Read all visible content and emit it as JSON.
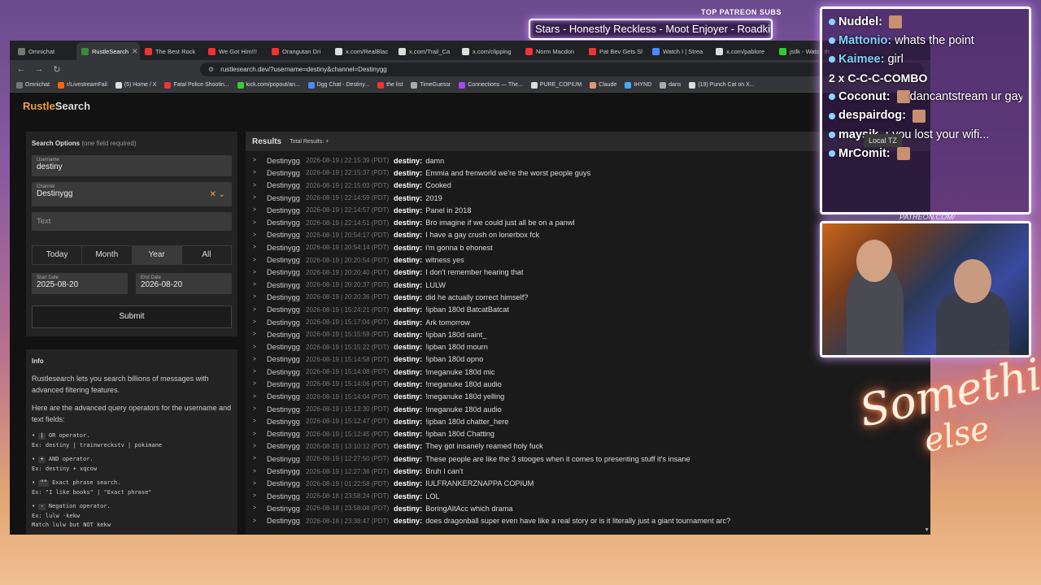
{
  "overlay": {
    "patreon_subs_label": "TOP PATREON SUBS",
    "subs_ticker": "Stars - Honestly Reckless - Moot Enjoyer - Roadkill - JRB",
    "patreon_url_label": "PATREON.COM/",
    "neon_line1": "Something",
    "neon_line2": "else"
  },
  "browser": {
    "tabs": [
      {
        "label": "Omnichat",
        "color": "#777"
      },
      {
        "label": "RustleSearch",
        "color": "#3a8a3a",
        "active": true
      },
      {
        "label": "The Best Rock",
        "color": "#e33"
      },
      {
        "label": "We Got Him!!!",
        "color": "#e33"
      },
      {
        "label": "Orangutan Dri",
        "color": "#e33"
      },
      {
        "label": "x.com/RealBlac",
        "color": "#ddd"
      },
      {
        "label": "x.com/Trail_Ca",
        "color": "#ddd"
      },
      {
        "label": "x.com/clipping",
        "color": "#ddd"
      },
      {
        "label": "Norm Macdon",
        "color": "#e33"
      },
      {
        "label": "Pat Bev Gets Sl",
        "color": "#e33"
      },
      {
        "label": "Watch I | Strea",
        "color": "#4a8aff"
      },
      {
        "label": "x.com/pablore",
        "color": "#ddd"
      },
      {
        "label": "jstlk - Watch th",
        "color": "#3c3"
      }
    ],
    "url": "rustlesearch.dev/?username=destiny&channel=Destinygg",
    "bookmarks": [
      {
        "label": "Omnichat",
        "color": "#777"
      },
      {
        "label": "r/LivestreamFail",
        "color": "#f60"
      },
      {
        "label": "(5) Home / X",
        "color": "#ddd"
      },
      {
        "label": "Fatal Police Shootin...",
        "color": "#e33"
      },
      {
        "label": "kick.com/popout/an...",
        "color": "#3c3"
      },
      {
        "label": "Dgg Chat - Destiny...",
        "color": "#4a8aff"
      },
      {
        "label": "the list",
        "color": "#e33"
      },
      {
        "label": "TimeGuessr",
        "color": "#aaa"
      },
      {
        "label": "Connections — The...",
        "color": "#a4f"
      },
      {
        "label": "PURE_COPIUM",
        "color": "#ddd"
      },
      {
        "label": "Claude",
        "color": "#d97"
      },
      {
        "label": "IHYND",
        "color": "#4af"
      },
      {
        "label": "dans",
        "color": "#aaa"
      },
      {
        "label": "(19) Punch Cat on X...",
        "color": "#ddd"
      }
    ]
  },
  "site": {
    "logo_a": "Rustle",
    "logo_b": "Search",
    "search": {
      "title": "Search Options",
      "subtitle": "(one field required)",
      "username_label": "Username",
      "username_value": "destiny",
      "channel_label": "Channel",
      "channel_value": "Destinygg",
      "text_placeholder": "Text",
      "ranges": [
        "Today",
        "Month",
        "Year",
        "All"
      ],
      "active_range": "Year",
      "start_label": "Start Date",
      "start_value": "2025-08-20",
      "end_label": "End Date",
      "end_value": "2026-08-20",
      "submit": "Submit"
    },
    "info": {
      "title": "Info",
      "p1": "Rustlesearch lets you search billions of messages with advanced filtering features.",
      "p2": "Here are the advanced query operators for the username and text fields:",
      "ops": [
        {
          "sym": "|",
          "desc": "OR operator.",
          "ex": "Ex: destiny | trainwreckstv | pokimane"
        },
        {
          "sym": "+",
          "desc": "AND operator.",
          "ex": "Ex: destiny + xqcow"
        },
        {
          "sym": "\"\"",
          "desc": "Exact phrase search.",
          "ex": "Ex: \"I like books\" | \"Exact phrase\""
        },
        {
          "sym": "-",
          "desc": "Negation operator.",
          "ex": "Ex: lulw -kekw",
          "ex2": "Match lulw but NOT kekw"
        }
      ]
    },
    "results": {
      "title": "Results",
      "count": "Total Results: +",
      "rows": [
        {
          "chan": "Destinygg",
          "ts": "2026-08-19 | 22:15:39 (PDT)",
          "user": "destiny:",
          "msg": "damn"
        },
        {
          "chan": "Destinygg",
          "ts": "2026-08-19 | 22:15:37 (PDT)",
          "user": "destiny:",
          "msg": "Emmia and frenworld we're the worst people guys"
        },
        {
          "chan": "Destinygg",
          "ts": "2026-08-19 | 22:15:03 (PDT)",
          "user": "destiny:",
          "msg": "Cooked"
        },
        {
          "chan": "Destinygg",
          "ts": "2026-08-19 | 22:14:59 (PDT)",
          "user": "destiny:",
          "msg": "2019"
        },
        {
          "chan": "Destinygg",
          "ts": "2026-08-19 | 22:14:57 (PDT)",
          "user": "destiny:",
          "msg": "Panel in 2018"
        },
        {
          "chan": "Destinygg",
          "ts": "2026-08-19 | 22:14:51 (PDT)",
          "user": "destiny:",
          "msg": "Bro imagine if we could just all be on a panwl"
        },
        {
          "chan": "Destinygg",
          "ts": "2026-08-19 | 20:54:17 (PDT)",
          "user": "destiny:",
          "msg": "I have a gay crush on lonerbox fck"
        },
        {
          "chan": "Destinygg",
          "ts": "2026-08-19 | 20:54:14 (PDT)",
          "user": "destiny:",
          "msg": "i'm gonna b ehonest"
        },
        {
          "chan": "Destinygg",
          "ts": "2026-08-19 | 20:20:54 (PDT)",
          "user": "destiny:",
          "msg": "witness yes"
        },
        {
          "chan": "Destinygg",
          "ts": "2026-08-19 | 20:20:40 (PDT)",
          "user": "destiny:",
          "msg": "I don't remember hearing that"
        },
        {
          "chan": "Destinygg",
          "ts": "2026-08-19 | 20:20:37 (PDT)",
          "user": "destiny:",
          "msg": "LULW"
        },
        {
          "chan": "Destinygg",
          "ts": "2026-08-19 | 20:20:36 (PDT)",
          "user": "destiny:",
          "msg": "did he actually correct himself?"
        },
        {
          "chan": "Destinygg",
          "ts": "2026-08-19 | 15:24:21 (PDT)",
          "user": "destiny:",
          "msg": "!ipban 180d BatcatBatcat"
        },
        {
          "chan": "Destinygg",
          "ts": "2026-08-19 | 15:17:04 (PDT)",
          "user": "destiny:",
          "msg": "Ark tomorrow"
        },
        {
          "chan": "Destinygg",
          "ts": "2026-08-19 | 15:15:59 (PDT)",
          "user": "destiny:",
          "msg": "!ipban 180d saint_"
        },
        {
          "chan": "Destinygg",
          "ts": "2026-08-19 | 15:15:22 (PDT)",
          "user": "destiny:",
          "msg": "!ipban 180d mourn"
        },
        {
          "chan": "Destinygg",
          "ts": "2026-08-19 | 15:14:58 (PDT)",
          "user": "destiny:",
          "msg": "!ipban 180d opno"
        },
        {
          "chan": "Destinygg",
          "ts": "2026-08-19 | 15:14:08 (PDT)",
          "user": "destiny:",
          "msg": "!meganuke 180d mic"
        },
        {
          "chan": "Destinygg",
          "ts": "2026-08-19 | 15:14:06 (PDT)",
          "user": "destiny:",
          "msg": "!meganuke 180d audio"
        },
        {
          "chan": "Destinygg",
          "ts": "2026-08-19 | 15:14:04 (PDT)",
          "user": "destiny:",
          "msg": "!meganuke 180d yelling"
        },
        {
          "chan": "Destinygg",
          "ts": "2026-08-19 | 15:13:30 (PDT)",
          "user": "destiny:",
          "msg": "!meganuke 180d audio"
        },
        {
          "chan": "Destinygg",
          "ts": "2026-08-19 | 15:12:47 (PDT)",
          "user": "destiny:",
          "msg": "!ipban 180d chatter_here"
        },
        {
          "chan": "Destinygg",
          "ts": "2026-08-19 | 15:12:45 (PDT)",
          "user": "destiny:",
          "msg": "!ipban 180d Chatting"
        },
        {
          "chan": "Destinygg",
          "ts": "2026-08-19 | 13:10:12 (PDT)",
          "user": "destiny:",
          "msg": "They got insanely reamed holy fuck"
        },
        {
          "chan": "Destinygg",
          "ts": "2026-08-19 | 12:27:50 (PDT)",
          "user": "destiny:",
          "msg": "These people are like the 3 stooges when it comes to presenting stuff it's insane"
        },
        {
          "chan": "Destinygg",
          "ts": "2026-08-19 | 12:27:36 (PDT)",
          "user": "destiny:",
          "msg": "Bruh I can't"
        },
        {
          "chan": "Destinygg",
          "ts": "2026-08-19 | 01:22:58 (PDT)",
          "user": "destiny:",
          "msg": "IULFRANKERZNAPPA COPIUM"
        },
        {
          "chan": "Destinygg",
          "ts": "2026-08-18 | 23:58:24 (PDT)",
          "user": "destiny:",
          "msg": "LOL"
        },
        {
          "chan": "Destinygg",
          "ts": "2026-08-18 | 23:58:08 (PDT)",
          "user": "destiny:",
          "msg": "BoringAltAcc which drama"
        },
        {
          "chan": "Destinygg",
          "ts": "2026-08-18 | 23:38:47 (PDT)",
          "user": "destiny:",
          "msg": "does dragonball super even have like a real story or is it literally just a giant tournament arc?"
        }
      ]
    }
  },
  "chat": {
    "lines": [
      {
        "user": "Nuddel:",
        "msg": "",
        "emote": true
      },
      {
        "user": "Mattonio:",
        "msg": "whats the point",
        "muser": true
      },
      {
        "user": "Kaimee:",
        "msg": "girl",
        "muser": true
      },
      {
        "user": "",
        "msg": "2 x C-C-C-COMBO",
        "combo": true
      },
      {
        "user": "Coconut:",
        "msg": "dancantstream ur gayh",
        "emote": true
      },
      {
        "user": "despairdog:",
        "msg": "",
        "emote": true
      },
      {
        "user": "maysik_:",
        "msg": "you lost your wifi..."
      },
      {
        "user": "MrComit:",
        "msg": "",
        "emote": true
      }
    ],
    "local_tz": "Local TZ"
  }
}
